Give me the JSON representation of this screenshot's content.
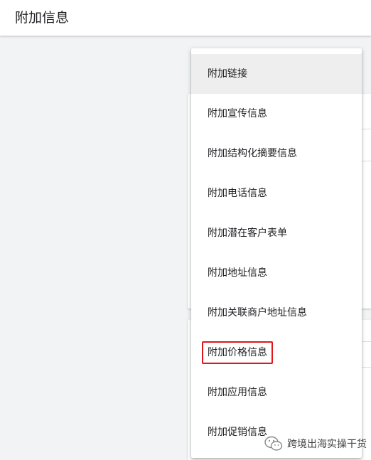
{
  "header": {
    "title": "附加信息"
  },
  "menu": {
    "items": [
      {
        "label": "附加链接"
      },
      {
        "label": "附加宣传信息"
      },
      {
        "label": "附加结构化摘要信息"
      },
      {
        "label": "附加电话信息"
      },
      {
        "label": "附加潜在客户表单"
      },
      {
        "label": "附加地址信息"
      },
      {
        "label": "附加关联商户地址信息"
      },
      {
        "label": "附加价格信息"
      },
      {
        "label": "附加应用信息"
      },
      {
        "label": "附加促销信息"
      }
    ],
    "active_index": 0,
    "highlighted_index": 7,
    "highlight_color": "#e0161b"
  },
  "watermark": {
    "text": "跨境出海实操干货",
    "icon": "wechat-icon"
  }
}
